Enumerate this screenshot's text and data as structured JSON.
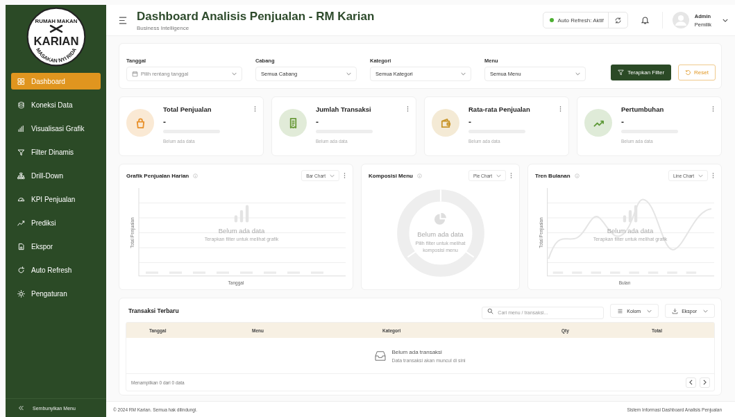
{
  "sidebar": {
    "logo": {
      "top": "RUMAH MAKAN",
      "name": "KARIAN",
      "bottom": "MASAKAN NYI RIDA"
    },
    "items": [
      {
        "label": "Dashboard",
        "selected": true
      },
      {
        "label": "Koneksi Data",
        "selected": false
      },
      {
        "label": "Visualisasi Grafik",
        "selected": false
      },
      {
        "label": "Filter Dinamis",
        "selected": false
      },
      {
        "label": "Drill-Down",
        "selected": false
      },
      {
        "label": "KPI Penjualan",
        "selected": false
      },
      {
        "label": "Prediksi",
        "selected": false
      },
      {
        "label": "Ekspor",
        "selected": false
      },
      {
        "label": "Auto Refresh",
        "selected": false
      },
      {
        "label": "Pengaturan",
        "selected": false
      }
    ],
    "collapse_label": "Sembunyikan Menu"
  },
  "header": {
    "title": "Dashboard Analisis Penjualan - RM Karian",
    "subtitle": "Business Intelligence",
    "auto_refresh": {
      "label": "Auto Refresh: Aktif",
      "on": true
    },
    "user": {
      "name": "Admin",
      "role": "Pemilik"
    }
  },
  "filters": [
    {
      "label": "Tanggal",
      "placeholder": "Pilih rentang tanggal"
    },
    {
      "label": "Cabang",
      "value": "Semua Cabang"
    },
    {
      "label": "Kategori",
      "value": "Semua Kategori"
    },
    {
      "label": "Menu",
      "value": "Semua Menu"
    }
  ],
  "filter_buttons": {
    "apply": "Terapkan Filter",
    "reset": "Reset"
  },
  "kpis": [
    {
      "title": "Total Penjualan",
      "value": "-",
      "note": "Belum ada data",
      "color": "#e8902a"
    },
    {
      "title": "Jumlah Transaksi",
      "value": "-",
      "note": "Belum ada data",
      "color": "#6a9a3a"
    },
    {
      "title": "Rata-rata Penjualan",
      "value": "-",
      "note": "Belum ada data",
      "color": "#c9962c"
    },
    {
      "title": "Pertumbuhan",
      "value": "-",
      "note": "Belum ada data",
      "color": "#5f9a3a"
    }
  ],
  "charts": [
    {
      "kind": "bar",
      "title": "Grafik Penjualan Harian",
      "type_select": "Bar Chart",
      "ylabel": "Total Penjualan",
      "xlabel": "Tanggal",
      "empty_title": "Belum ada data",
      "empty_hint": "Terapkan filter untuk melihat grafik"
    },
    {
      "kind": "pie",
      "title": "Komposisi Menu",
      "type_select": "Pie Chart",
      "empty_title": "Belum ada data",
      "empty_hint": "Pilih filter untuk melihat komposisi menu"
    },
    {
      "kind": "line",
      "title": "Tren Bulanan",
      "type_select": "Line Chart",
      "ylabel": "Total Penjualan",
      "xlabel": "Bulan",
      "empty_title": "Belum ada data",
      "empty_hint": "Terapkan filter untuk melihat grafik"
    }
  ],
  "table": {
    "title": "Transaksi Terbaru",
    "search": {
      "placeholder": "Cari menu / transaksi..."
    },
    "columns_button": "Kolom",
    "export_button": "Ekspor",
    "columns": [
      "Tanggal",
      "Menu",
      "Kategori",
      "Qty",
      "Total"
    ],
    "empty_title": "Belum ada transaksi",
    "empty_hint": "Data transaksi akan muncul di sini",
    "summary": "Menampilkan 0 dari 0 data"
  },
  "footer": {
    "left": "© 2024 RM Karian. Semua hak dilindungi.",
    "right": "Sistem Informasi Dashboard Analisis Penjualan"
  }
}
